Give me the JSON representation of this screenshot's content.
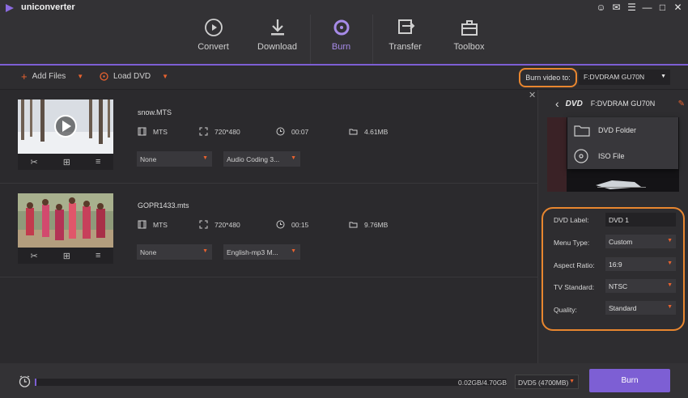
{
  "app": {
    "name": "uniconverter",
    "logo_icon": "play-triangle-icon"
  },
  "window_controls": [
    "user-icon",
    "feedback-icon",
    "menu-icon",
    "minimize-icon",
    "maximize-icon",
    "close-icon"
  ],
  "nav": {
    "tabs": [
      {
        "label": "Convert",
        "icon": "convert-icon",
        "active": false
      },
      {
        "label": "Download",
        "icon": "download-icon",
        "active": false
      },
      {
        "label": "Burn",
        "icon": "burn-disc-icon",
        "active": true
      },
      {
        "label": "Transfer",
        "icon": "transfer-icon",
        "active": false
      },
      {
        "label": "Toolbox",
        "icon": "toolbox-icon",
        "active": false
      }
    ]
  },
  "toolbar": {
    "add_files": "Add Files",
    "load_dvd": "Load DVD",
    "burn_to_label": "Burn video to:",
    "burn_to_value": "F:DVDRAM GU70N"
  },
  "files": [
    {
      "name": "snow.MTS",
      "format": "MTS",
      "resolution": "720*480",
      "duration": "00:07",
      "size": "4.61MB",
      "subtitle": "None",
      "audio": "Audio Coding 3..."
    },
    {
      "name": "GOPR1433.mts",
      "format": "MTS",
      "resolution": "720*480",
      "duration": "00:15",
      "size": "9.76MB",
      "subtitle": "None",
      "audio": "English-mp3 M..."
    }
  ],
  "right_panel": {
    "drive_name": "F:DVDRAM GU70N",
    "menu_options": [
      "DVD Folder",
      "ISO File"
    ],
    "settings": {
      "dvd_label": {
        "label": "DVD Label:",
        "value": "DVD 1"
      },
      "menu_type": {
        "label": "Menu Type:",
        "value": "Custom"
      },
      "aspect_ratio": {
        "label": "Aspect Ratio:",
        "value": "16:9"
      },
      "tv_standard": {
        "label": "TV Standard:",
        "value": "NTSC"
      },
      "quality": {
        "label": "Quality:",
        "value": "Standard"
      }
    }
  },
  "bottom": {
    "usage": "0.02GB/4.70GB",
    "usage_fraction": 0.004,
    "disc_type": "DVD5 (4700MB)",
    "burn_button": "Burn"
  },
  "colors": {
    "accent": "#7d5fd4",
    "highlight_orange": "#e8862f",
    "caret_orange": "#e8622f"
  }
}
